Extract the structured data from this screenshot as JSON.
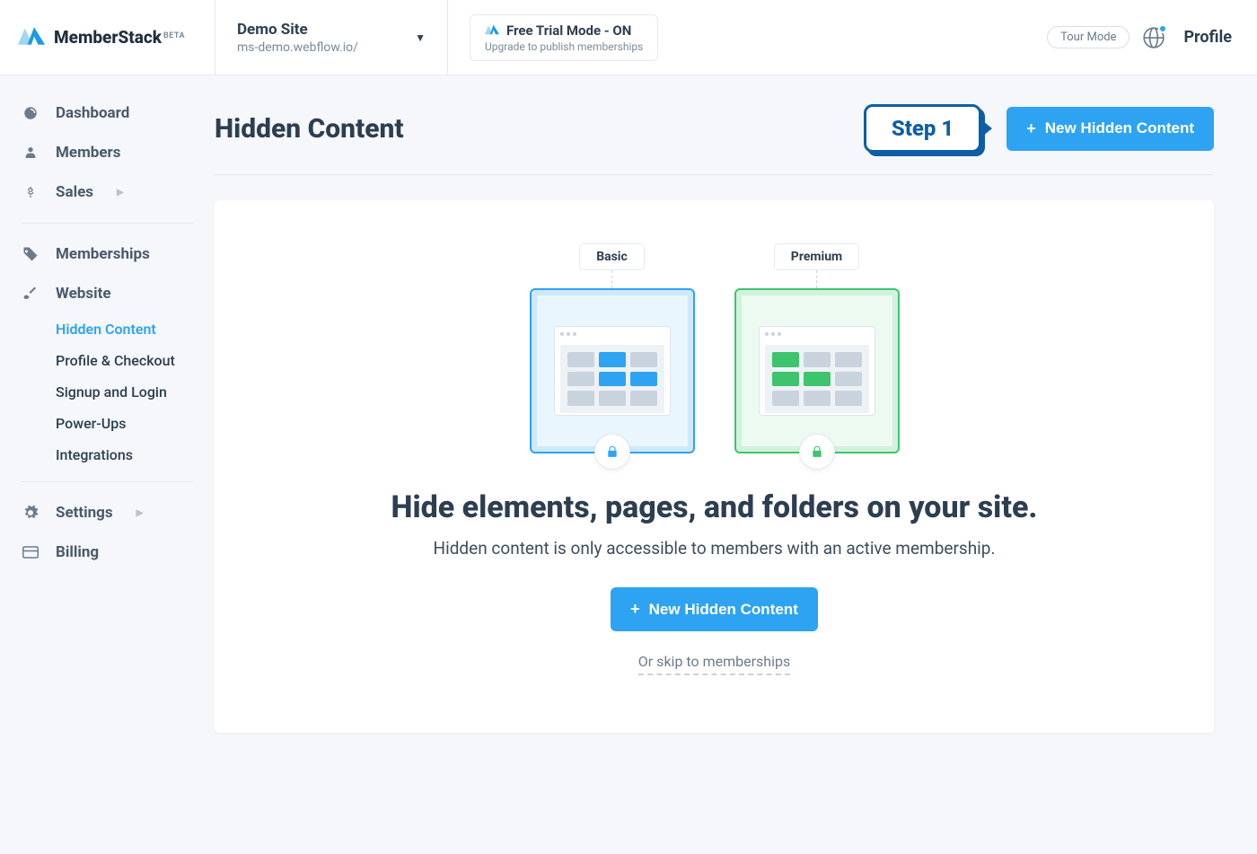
{
  "brand": {
    "name": "MemberStack",
    "tag": "BETA"
  },
  "site": {
    "name": "Demo Site",
    "url": "ms-demo.webflow.io/"
  },
  "trial": {
    "title": "Free Trial Mode - ON",
    "sub": "Upgrade to publish memberships"
  },
  "topbar": {
    "tour": "Tour Mode",
    "profile": "Profile"
  },
  "nav": {
    "dashboard": "Dashboard",
    "members": "Members",
    "sales": "Sales",
    "memberships": "Memberships",
    "website": "Website",
    "settings": "Settings",
    "billing": "Billing"
  },
  "subnav": {
    "hidden": "Hidden Content",
    "profile": "Profile & Checkout",
    "signup": "Signup and Login",
    "powerups": "Power-Ups",
    "integrations": "Integrations"
  },
  "page": {
    "title": "Hidden Content",
    "step": "Step 1",
    "new_btn": "New Hidden Content"
  },
  "hero": {
    "tier_basic": "Basic",
    "tier_premium": "Premium",
    "title": "Hide elements, pages, and folders on your site.",
    "subtitle": "Hidden content is only accessible to members with an active membership.",
    "cta": "New Hidden Content",
    "skip": "Or skip to memberships"
  },
  "colors": {
    "primary": "#2ea3f2",
    "accent": "#0d5ea6",
    "green": "#3ec46d"
  }
}
